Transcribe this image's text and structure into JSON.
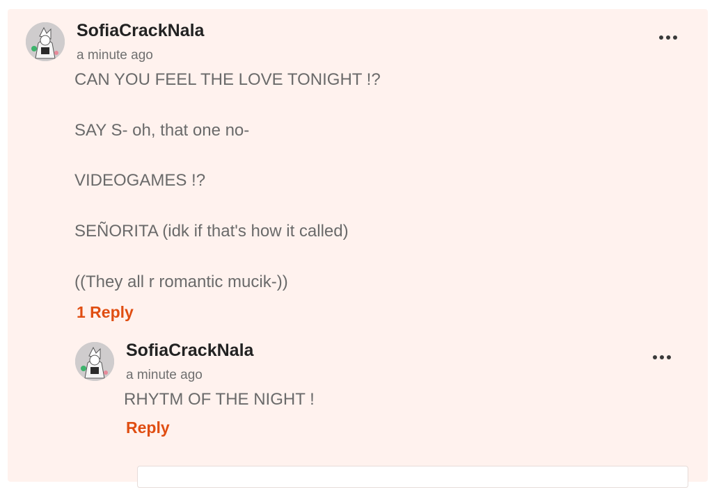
{
  "comment": {
    "username": "SofiaCrackNala",
    "timestamp": "a minute ago",
    "avatar_icon": "avatar-icon",
    "lines": [
      "CAN YOU FEEL THE LOVE TONIGHT !?",
      "SAY S- oh, that one no-",
      "VIDEOGAMES !?",
      "SEÑORITA (idk if that's how it called)",
      "((They all r romantic mucik-))"
    ],
    "reply_count_label": "1 Reply",
    "menu_icon": "more-dots-icon"
  },
  "reply": {
    "username": "SofiaCrackNala",
    "timestamp": "a minute ago",
    "avatar_icon": "avatar-icon",
    "text": "RHYTM OF THE NIGHT !",
    "reply_label": "Reply",
    "menu_icon": "more-dots-icon"
  },
  "colors": {
    "panel_bg": "#fff2ee",
    "accent": "#e04e12",
    "text": "#6a6a6a",
    "username": "#222222"
  }
}
